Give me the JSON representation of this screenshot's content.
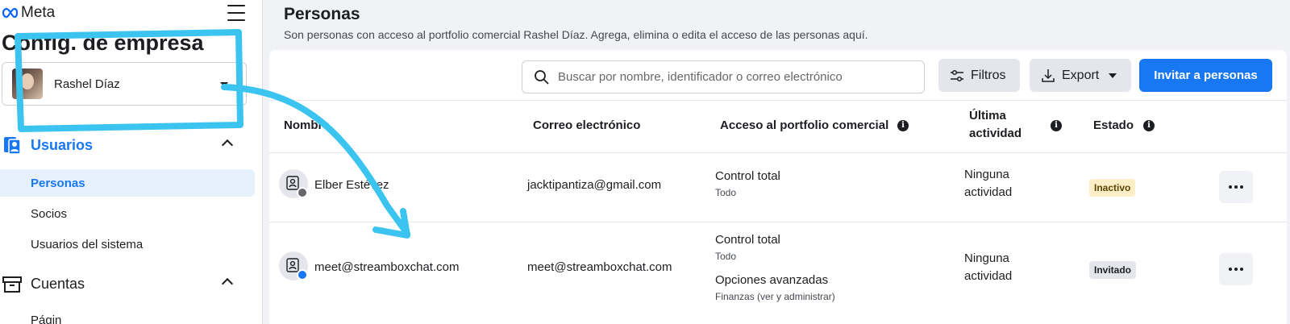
{
  "sidebar": {
    "brand": "Meta",
    "title": "Config. de empresa",
    "account_name": "Rashel Díaz",
    "sections": [
      {
        "label": "Usuarios",
        "icon": "users-icon"
      },
      {
        "label": "Cuentas",
        "icon": "briefcase-icon"
      }
    ],
    "items": [
      {
        "label": "Personas",
        "selected": true
      },
      {
        "label": "Socios"
      },
      {
        "label": "Usuarios del sistema"
      },
      {
        "label": "Págin"
      }
    ]
  },
  "main": {
    "title": "Personas",
    "subtitle": "Son personas con acceso al portfolio comercial Rashel Díaz. Agrega, elimina o edita el acceso de las personas aquí.",
    "search_placeholder": "Buscar por nombre, identificador o correo electrónico",
    "filters_label": "Filtros",
    "export_label": "Export",
    "invite_label": "Invitar a personas",
    "columns": {
      "name": "Nombre",
      "email": "Correo electrónico",
      "access": "Acceso al portfolio comercial",
      "last_activity_1": "Última",
      "last_activity_2": "actividad",
      "status": "Estado"
    },
    "rows": [
      {
        "name": "Elber Estévez",
        "email": "jacktipantiza@gmail.com",
        "access_title": "Control total",
        "access_detail": "Todo",
        "activity_1": "Ninguna",
        "activity_2": "actividad",
        "status": "Inactivo",
        "status_color": "#fcefc7"
      },
      {
        "name": "meet@streamboxchat.com",
        "email": "meet@streamboxchat.com",
        "access_title": "Control total",
        "access_detail": "Todo",
        "access_title_2": "Opciones avanzadas",
        "access_detail_2": "Finanzas (ver y administrar)",
        "activity_1": "Ninguna",
        "activity_2": "actividad",
        "status": "Invitado",
        "status_color": "#e4e6eb"
      }
    ]
  },
  "colors": {
    "accent": "#1877f2",
    "annotation": "#3cc4f0"
  }
}
